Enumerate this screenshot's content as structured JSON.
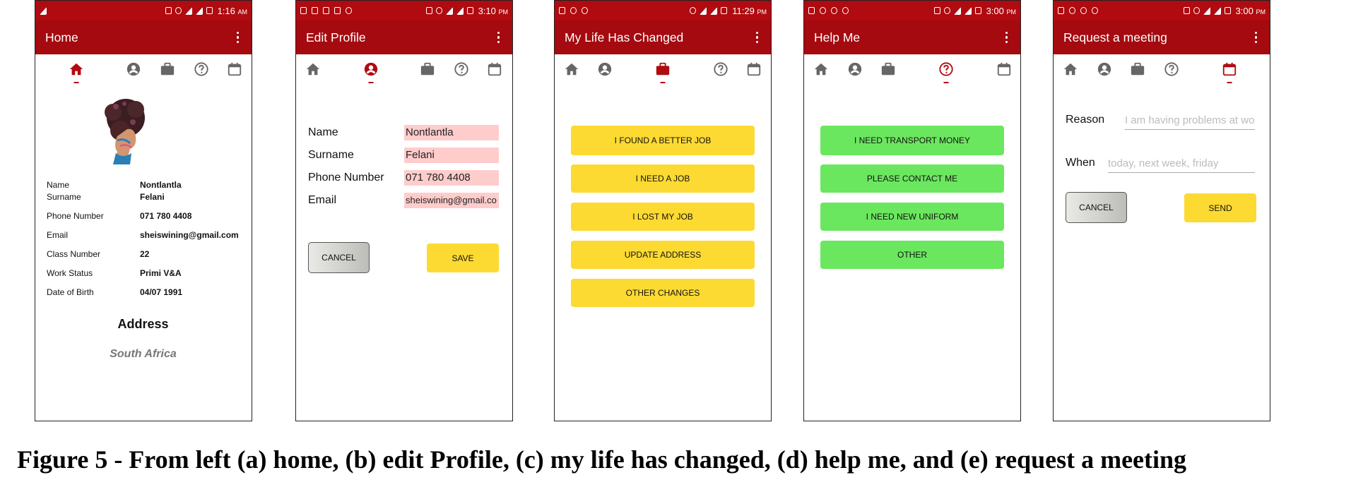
{
  "colors": {
    "primary": "#a40a0f",
    "status_bar": "#b00b10",
    "yellow_button": "#fdda32",
    "green_button": "#6be75f",
    "field_pink": "#ffcccc"
  },
  "screens": {
    "home": {
      "time": "1:16",
      "ampm": "AM",
      "title": "Home",
      "active_tab": "home",
      "profile_rows": [
        {
          "label": "Name",
          "value": "Nontlantla"
        },
        {
          "label": "Surname",
          "value": "Felani"
        },
        {
          "label": "Phone Number",
          "value": "071 780 4408"
        },
        {
          "label": "Email",
          "value": "sheiswining@gmail.com"
        },
        {
          "label": "Class Number",
          "value": "22"
        },
        {
          "label": "Work Status",
          "value": "Primi V&A"
        },
        {
          "label": "Date of Birth",
          "value": "04/07 1991"
        }
      ],
      "address_heading": "Address",
      "address_value": "South Africa"
    },
    "edit_profile": {
      "time": "3:10",
      "ampm": "PM",
      "title": "Edit Profile",
      "active_tab": "profile",
      "fields": [
        {
          "label": "Name",
          "value": "Nontlantla"
        },
        {
          "label": "Surname",
          "value": "Felani"
        },
        {
          "label": "Phone Number",
          "value": "071 780 4408"
        },
        {
          "label": "Email",
          "value": "sheiswining@gmail.co"
        }
      ],
      "cancel_label": "CANCEL",
      "save_label": "SAVE"
    },
    "life_changed": {
      "time": "11:29",
      "ampm": "PM",
      "title": "My Life Has Changed",
      "active_tab": "work",
      "buttons": [
        "I FOUND A BETTER JOB",
        "I NEED A JOB",
        "I LOST MY JOB",
        "UPDATE ADDRESS",
        "OTHER CHANGES"
      ]
    },
    "help_me": {
      "time": "3:00",
      "ampm": "PM",
      "title": "Help Me",
      "active_tab": "help",
      "buttons": [
        "I NEED TRANSPORT MONEY",
        "PLEASE CONTACT ME",
        "I NEED NEW UNIFORM",
        "OTHER"
      ]
    },
    "request_meeting": {
      "time": "3:00",
      "ampm": "PM",
      "title": "Request a meeting",
      "active_tab": "calendar",
      "reason_label": "Reason",
      "reason_placeholder": "I am having problems at wo",
      "when_label": "When",
      "when_placeholder": "today, next week, friday",
      "cancel_label": "CANCEL",
      "send_label": "SEND"
    }
  },
  "signal": {
    "network": "3G",
    "edge": "E"
  },
  "caption": "Figure 5 - From left (a) home, (b) edit Profile, (c) my life has changed, (d) help me, and (e) request a meeting"
}
